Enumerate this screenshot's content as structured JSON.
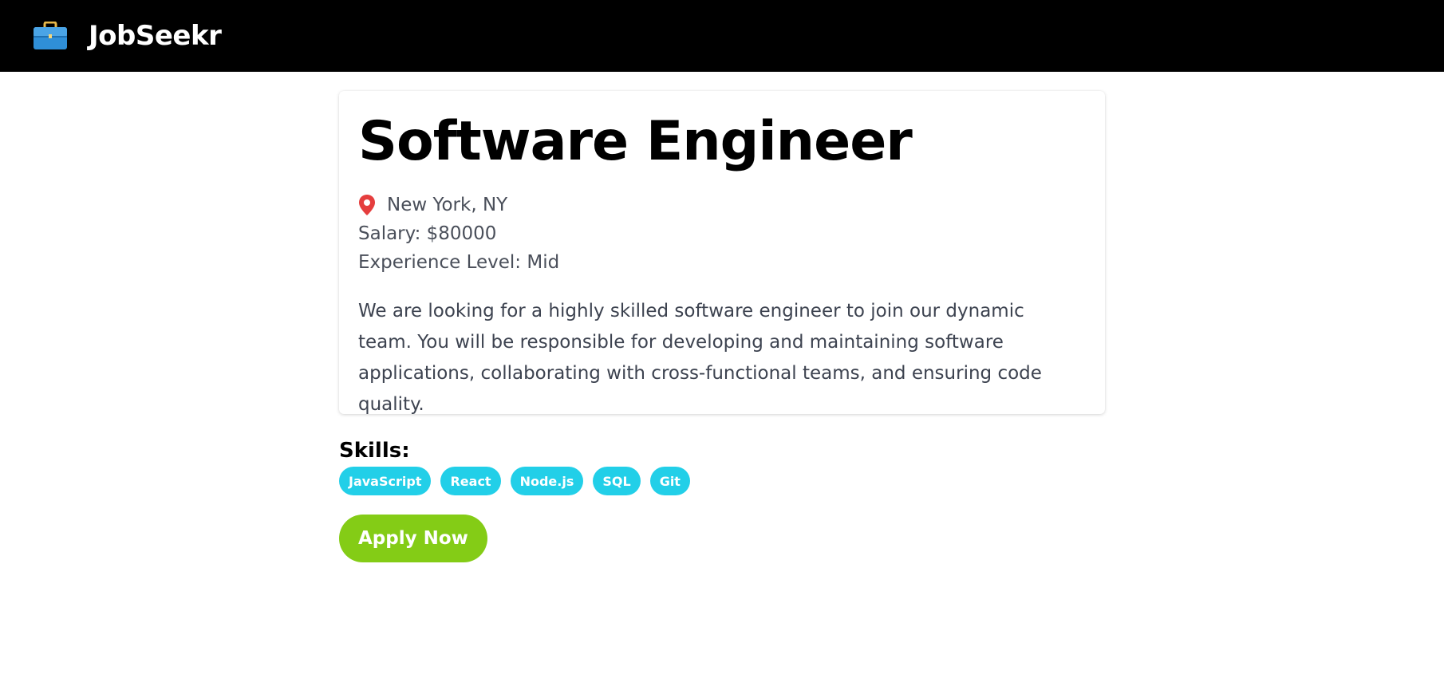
{
  "header": {
    "logo_icon": "briefcase-icon",
    "brand": "JobSeekr"
  },
  "job": {
    "title": "Software Engineer",
    "location_icon": "map-pin-icon",
    "location": "New York, NY",
    "salary": "Salary: $80000",
    "experience": "Experience Level: Mid",
    "description": "We are looking for a highly skilled software engineer to join our dynamic team. You will be responsible for developing and maintaining software applications, collaborating with cross-functional teams, and ensuring code quality."
  },
  "skills": {
    "heading": "Skills:",
    "items": [
      "JavaScript",
      "React",
      "Node.js",
      "SQL",
      "Git"
    ]
  },
  "actions": {
    "apply_label": "Apply Now"
  },
  "colors": {
    "navbar_bg": "#000000",
    "skill_tag_bg": "#22cfe8",
    "apply_button_bg": "#84cc16",
    "pin_red": "#e53e3e"
  }
}
